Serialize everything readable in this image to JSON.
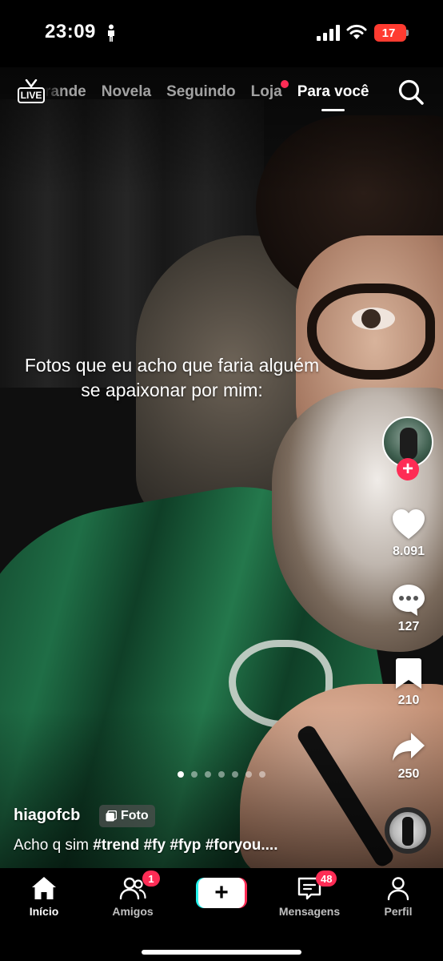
{
  "status_bar": {
    "time": "23:09",
    "battery": "17",
    "battery_color": "#ff3b30",
    "icons": [
      "person-icon",
      "signal-icon",
      "wifi-icon",
      "battery-icon"
    ]
  },
  "top_nav": {
    "live_label": "LIVE",
    "tabs": [
      {
        "label": "rande",
        "active": false
      },
      {
        "label": "Novela",
        "active": false
      },
      {
        "label": "Seguindo",
        "active": false
      },
      {
        "label": "Loja",
        "active": false,
        "has_dot": true
      },
      {
        "label": "Para você",
        "active": true
      }
    ],
    "search_icon": "search-icon"
  },
  "post": {
    "caption_overlay": "Fotos que eu acho que faria alguém se apaixonar por mim:",
    "username": "hiagofcb",
    "badge_label": "Foto",
    "description_text": "Acho q sim ",
    "description_tags": "#trend #fy #fyp #foryou....",
    "carousel": {
      "total": 7,
      "active_index": 0
    }
  },
  "rail": {
    "likes": "8.091",
    "comments": "127",
    "saves": "210",
    "shares": "250",
    "follow_symbol": "+"
  },
  "bottom_nav": {
    "home_label": "Início",
    "friends_label": "Amigos",
    "friends_badge": "1",
    "create_symbol": "+",
    "inbox_label": "Mensagens",
    "inbox_badge": "48",
    "profile_label": "Perfil"
  },
  "colors": {
    "accent": "#fe2c55",
    "accent_cyan": "#25f4ee",
    "background": "#000000"
  }
}
